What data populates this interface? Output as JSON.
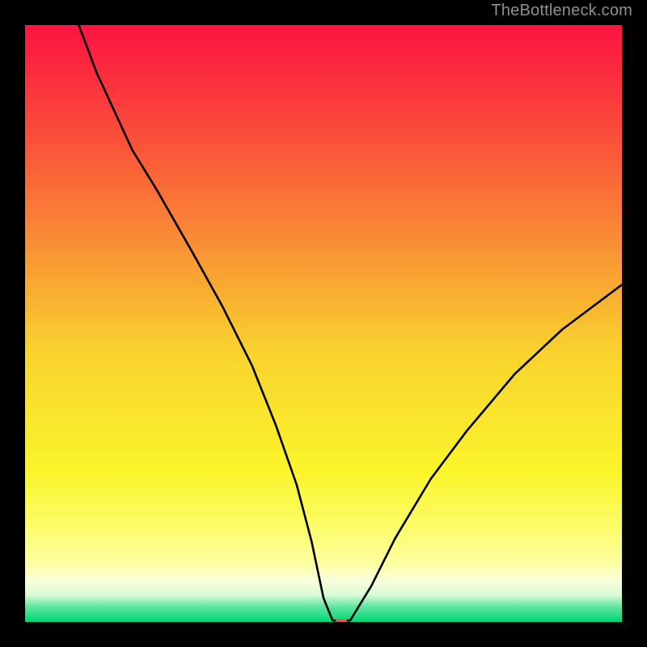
{
  "watermark": "TheBottleneck.com",
  "chart_data": {
    "type": "line",
    "title": "",
    "xlabel": "",
    "ylabel": "",
    "xlim": [
      0,
      100
    ],
    "ylim": [
      0,
      100
    ],
    "grid": false,
    "legend": false,
    "gradient_stops": [
      {
        "offset": 0.0,
        "color": "#fd1442"
      },
      {
        "offset": 0.18,
        "color": "#fb4c3a"
      },
      {
        "offset": 0.35,
        "color": "#f98935"
      },
      {
        "offset": 0.55,
        "color": "#f9d32e"
      },
      {
        "offset": 0.75,
        "color": "#faf52b"
      },
      {
        "offset": 0.84,
        "color": "#fcfc69"
      },
      {
        "offset": 0.9,
        "color": "#feff9f"
      },
      {
        "offset": 0.93,
        "color": "#fafedb"
      },
      {
        "offset": 0.955,
        "color": "#d9f9d7"
      },
      {
        "offset": 0.975,
        "color": "#5de59e"
      },
      {
        "offset": 1.0,
        "color": "#00d676"
      }
    ],
    "curve": {
      "x": [
        9.0,
        12.0,
        18.0,
        22.0,
        28.0,
        33.0,
        38.0,
        42.0,
        45.5,
        48.0,
        50.0,
        51.5,
        53.0,
        54.5,
        58.0,
        62.0,
        68.0,
        74.0,
        82.0,
        90.0,
        100.0
      ],
      "y": [
        100.0,
        92.0,
        79.0,
        72.5,
        62.0,
        53.0,
        43.0,
        33.0,
        23.0,
        13.5,
        4.0,
        0.3,
        0.0,
        0.3,
        6.0,
        14.0,
        24.0,
        32.0,
        41.5,
        49.0,
        56.5
      ],
      "note": "y is percent height above baseline (0 = bottom green band, 100 = top of gradient area)"
    },
    "marker": {
      "x": 53.0,
      "y": 0.0,
      "rx": 1.0,
      "ry": 0.55,
      "color": "#d9605a"
    }
  }
}
